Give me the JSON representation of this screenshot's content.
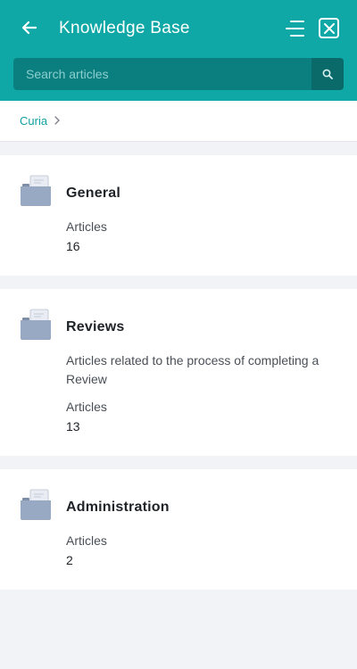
{
  "header": {
    "title": "Knowledge Base",
    "back_icon": "arrow-left-icon",
    "menu_icon": "menu-lines-icon",
    "close_icon": "close-box-icon",
    "bg_color": "#0fa8a6"
  },
  "search": {
    "placeholder": "Search articles",
    "value": "",
    "icon": "search-icon"
  },
  "breadcrumb": {
    "items": [
      "Curia"
    ],
    "separator_icon": "chevron-right-icon"
  },
  "categories": [
    {
      "title": "General",
      "description": "",
      "count_label": "Articles",
      "count": "16",
      "icon": "folder-icon"
    },
    {
      "title": "Reviews",
      "description": "Articles related to the process of completing a Review",
      "count_label": "Articles",
      "count": "13",
      "icon": "folder-icon"
    },
    {
      "title": "Administration",
      "description": "",
      "count_label": "Articles",
      "count": "2",
      "icon": "folder-icon"
    }
  ]
}
